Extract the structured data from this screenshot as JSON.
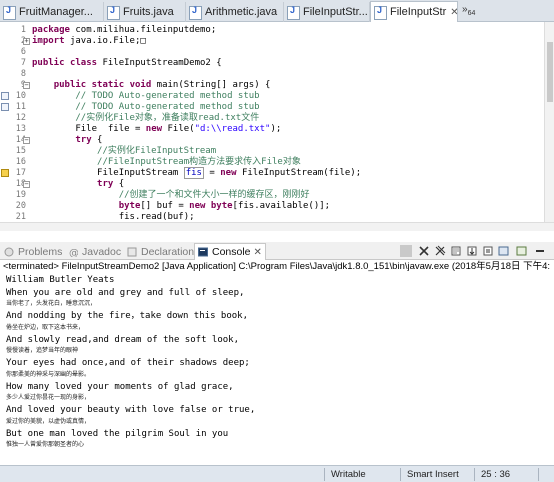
{
  "editor_tabs": [
    {
      "label": "FruitManager..."
    },
    {
      "label": "Fruits.java"
    },
    {
      "label": "Arithmetic.java"
    },
    {
      "label": "FileInputStr..."
    },
    {
      "label": "FileInputStr",
      "active": true,
      "close": "✕"
    }
  ],
  "tabs_overflow": {
    "symbol": "»",
    "count": "64"
  },
  "code_lines": [
    {
      "num": "1",
      "parts": [
        {
          "t": "package ",
          "c": "kw"
        },
        {
          "t": "com.milihua.fileinputdemo;"
        }
      ]
    },
    {
      "num": "2",
      "fold": "+",
      "parts": [
        {
          "t": "import ",
          "c": "kw"
        },
        {
          "t": "java.io.File;"
        },
        {
          "t": "□"
        }
      ]
    },
    {
      "num": "6",
      "parts": []
    },
    {
      "num": "7",
      "parts": [
        {
          "t": "public ",
          "c": "kw"
        },
        {
          "t": "class ",
          "c": "kw"
        },
        {
          "t": "FileInputStreamDemo2 {"
        }
      ]
    },
    {
      "num": "8",
      "parts": []
    },
    {
      "num": "9",
      "fold": "−",
      "parts": [
        {
          "t": "    "
        },
        {
          "t": "public ",
          "c": "kw"
        },
        {
          "t": "static ",
          "c": "kw"
        },
        {
          "t": "void ",
          "c": "kw"
        },
        {
          "t": "main(String[] args) {"
        }
      ]
    },
    {
      "num": "10",
      "marker": "task",
      "parts": [
        {
          "t": "        "
        },
        {
          "t": "// TODO Auto-generated method stub",
          "c": "cm"
        }
      ]
    },
    {
      "num": "11",
      "marker": "task",
      "parts": [
        {
          "t": "        "
        },
        {
          "t": "// TODO Auto-generated method stub",
          "c": "cm"
        }
      ]
    },
    {
      "num": "12",
      "parts": [
        {
          "t": "        "
        },
        {
          "t": "//实例化File对象，准备读取read.txt文件",
          "c": "cm"
        }
      ]
    },
    {
      "num": "13",
      "parts": [
        {
          "t": "        File  file = "
        },
        {
          "t": "new ",
          "c": "kw"
        },
        {
          "t": "File("
        },
        {
          "t": "\"d:\\\\read.txt\"",
          "c": "st"
        },
        {
          "t": ");"
        }
      ]
    },
    {
      "num": "14",
      "fold": "−",
      "parts": [
        {
          "t": "        "
        },
        {
          "t": "try ",
          "c": "kw"
        },
        {
          "t": "{"
        }
      ]
    },
    {
      "num": "15",
      "parts": [
        {
          "t": "            "
        },
        {
          "t": "//实例化FileInputStream",
          "c": "cm"
        }
      ]
    },
    {
      "num": "16",
      "parts": [
        {
          "t": "            "
        },
        {
          "t": "//FileInputStream构造方法要求传入File对象",
          "c": "cm"
        }
      ]
    },
    {
      "num": "17",
      "marker": "warn",
      "parts": [
        {
          "t": "            FileInputStream "
        },
        {
          "t": "fis",
          "c": "hl"
        },
        {
          "t": " = "
        },
        {
          "t": "new ",
          "c": "kw"
        },
        {
          "t": "FileInputStream(file);"
        }
      ]
    },
    {
      "num": "18",
      "fold": "−",
      "parts": [
        {
          "t": "            "
        },
        {
          "t": "try ",
          "c": "kw"
        },
        {
          "t": "{"
        }
      ]
    },
    {
      "num": "19",
      "parts": [
        {
          "t": "                "
        },
        {
          "t": "//创建了一个和文件大小一样的缓存区，刚刚好",
          "c": "cm"
        }
      ]
    },
    {
      "num": "20",
      "parts": [
        {
          "t": "                "
        },
        {
          "t": "byte",
          "c": "kw"
        },
        {
          "t": "[] buf = "
        },
        {
          "t": "new ",
          "c": "kw"
        },
        {
          "t": "byte",
          "c": "kw"
        },
        {
          "t": "[fis.available()];"
        }
      ]
    },
    {
      "num": "21",
      "parts": [
        {
          "t": "                fis.read(buf);"
        }
      ]
    }
  ],
  "view_tabs": [
    {
      "label": "Problems"
    },
    {
      "label": "Javadoc"
    },
    {
      "label": "Declaration"
    },
    {
      "label": "Console",
      "active": true,
      "close": "✕"
    }
  ],
  "console_header": "<terminated> FileInputStreamDemo2 [Java Application] C:\\Program Files\\Java\\jdk1.8.0_151\\bin\\javaw.exe (2018年5月18日 下午4:",
  "console_lines": [
    {
      "text": "William Butler Yeats"
    },
    {
      "text": "When you are old and grey and full of sleep,"
    },
    {
      "text": "当你老了，头发花白，睡意沉沉，",
      "small": true
    },
    {
      "text": "And nodding by the fire，take down this book,"
    },
    {
      "text": "倦坐在炉边，取下这本书来，",
      "small": true
    },
    {
      "text": "And slowly read,and dream of the soft look,"
    },
    {
      "text": "慢慢读着，追梦当年的眼神",
      "small": true
    },
    {
      "text": "Your eyes had once,and of their shadows deep;"
    },
    {
      "text": "你那柔美的神采与深幽的晕影。",
      "small": true
    },
    {
      "text": "How many loved your moments of glad grace,"
    },
    {
      "text": "多少人爱过你昙花一现的身影，",
      "small": true
    },
    {
      "text": "And loved your beauty with love false or true,"
    },
    {
      "text": "爱过你的美貌，以虚伪或真情，",
      "small": true
    },
    {
      "text": "But one man loved the pilgrim Soul in you"
    },
    {
      "text": "惟独一人曾爱你那朝圣者的心",
      "small": true
    }
  ],
  "status": {
    "mode": "Writable",
    "insert": "Smart Insert",
    "position": "25 : 36"
  }
}
